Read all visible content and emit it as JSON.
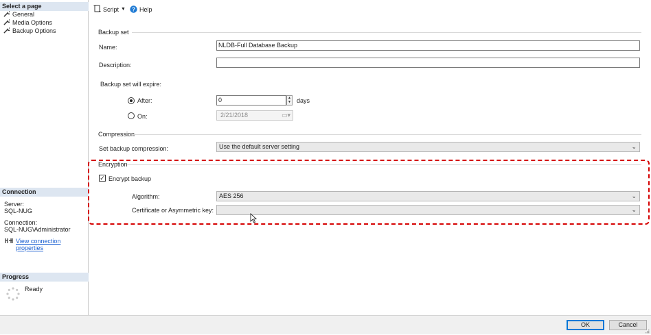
{
  "sidebar": {
    "select_page_header": "Select a page",
    "pages": [
      {
        "label": "General",
        "icon": "wrench-icon"
      },
      {
        "label": "Media Options",
        "icon": "wrench-icon"
      },
      {
        "label": "Backup Options",
        "icon": "wrench-icon"
      }
    ],
    "connection_header": "Connection",
    "server_label": "Server:",
    "server_value": "SQL-NUG",
    "connection_label": "Connection:",
    "connection_value": "SQL-NUG\\Administrator",
    "view_connection_link": "View connection properties",
    "progress_header": "Progress",
    "progress_status": "Ready"
  },
  "toolbar": {
    "script_label": "Script",
    "help_label": "Help"
  },
  "backup_set": {
    "title": "Backup set",
    "name_label": "Name:",
    "name_value": "NLDB-Full Database Backup",
    "description_label": "Description:",
    "description_value": "",
    "expire_label": "Backup set will expire:",
    "after_label": "After:",
    "after_value": "0",
    "after_unit": "days",
    "on_label": "On:",
    "on_value": "2/21/2018",
    "selected_option": "After"
  },
  "compression": {
    "title": "Compression",
    "set_label": "Set backup compression:",
    "value": "Use the default server setting"
  },
  "encryption": {
    "title": "Encryption",
    "encrypt_label": "Encrypt backup",
    "encrypt_checked": true,
    "algorithm_label": "Algorithm:",
    "algorithm_value": "AES 256",
    "certificate_label": "Certificate or Asymmetric key:",
    "certificate_value": ""
  },
  "buttons": {
    "ok": "OK",
    "cancel": "Cancel"
  },
  "colors": {
    "highlight": "#d50000",
    "pane_header": "#dde6f1",
    "link": "#1a5fd1",
    "help_icon": "#1e7ad4"
  }
}
